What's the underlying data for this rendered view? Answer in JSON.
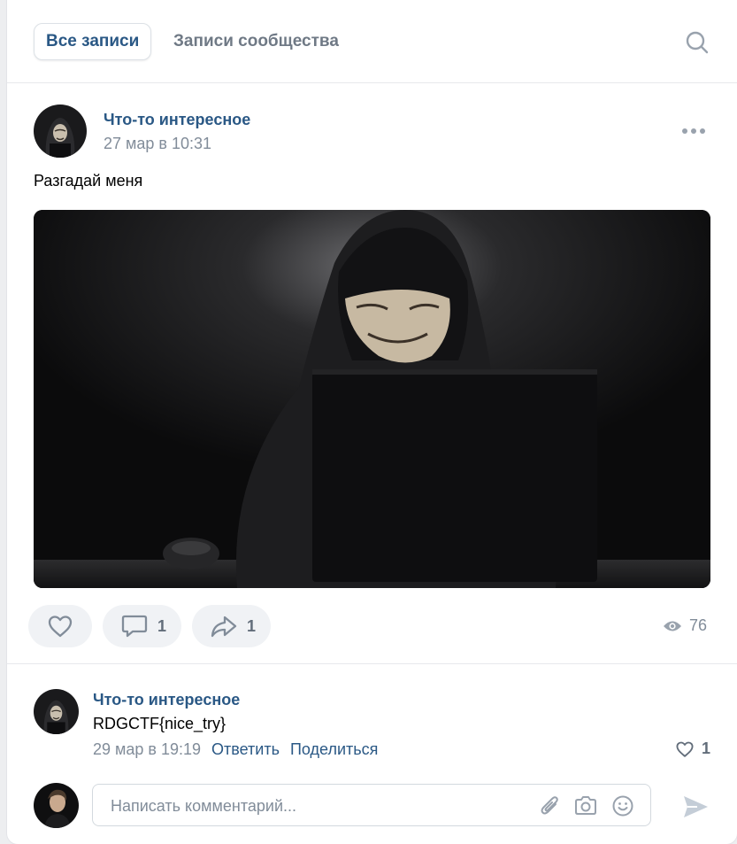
{
  "tabs": {
    "all_posts": "Все записи",
    "community_posts": "Записи сообщества",
    "search_icon": "search-icon"
  },
  "post": {
    "author": "Что-то интересное",
    "date": "27 мар в 10:31",
    "text": "Разгадай меня",
    "image": "hooded-figure-anonymous-mask-laptop",
    "likes": "",
    "comments": "1",
    "shares": "1",
    "views": "76"
  },
  "comment": {
    "author": "Что-то интересное",
    "text": "RDGCTF{nice_try}",
    "date": "29 мар в 19:19",
    "reply_label": "Ответить",
    "share_label": "Поделиться",
    "likes": "1"
  },
  "comment_input": {
    "placeholder": "Написать комментарий..."
  },
  "colors": {
    "link": "#2a5885",
    "secondary": "#818c99",
    "action_bg": "#f0f2f5",
    "icon": "#99a2ad"
  }
}
